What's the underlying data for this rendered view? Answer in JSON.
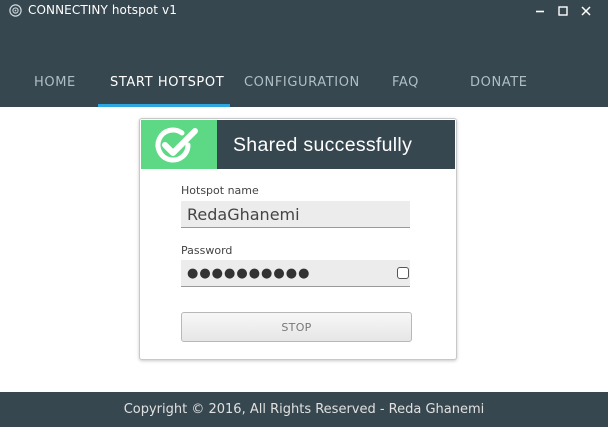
{
  "window": {
    "title": "CONNECTINY hotspot v1",
    "icons": {
      "app": "app-logo-icon",
      "minimize": "minimize-icon",
      "maximize": "maximize-icon",
      "close": "close-icon"
    }
  },
  "nav": {
    "tabs": [
      {
        "label": "HOME",
        "active": false
      },
      {
        "label": "START HOTSPOT",
        "active": true
      },
      {
        "label": "CONFIGURATION",
        "active": false
      },
      {
        "label": "FAQ",
        "active": false
      },
      {
        "label": "DONATE",
        "active": false
      }
    ]
  },
  "status": {
    "message": "Shared successfully",
    "icon": "check-circle-icon",
    "color": "#5dd885"
  },
  "form": {
    "hotspot_name_label": "Hotspot name",
    "hotspot_name_value": "RedaGhanemi",
    "password_label": "Password",
    "password_masked": "●●●●●●●●●●",
    "show_password_checked": false,
    "stop_button_label": "STOP"
  },
  "footer": {
    "copyright": "Copyright © 2016, All Rights Reserved - Reda Ghanemi"
  },
  "colors": {
    "header_bg": "#37474f",
    "accent": "#2ea7e0",
    "success": "#5dd885"
  }
}
